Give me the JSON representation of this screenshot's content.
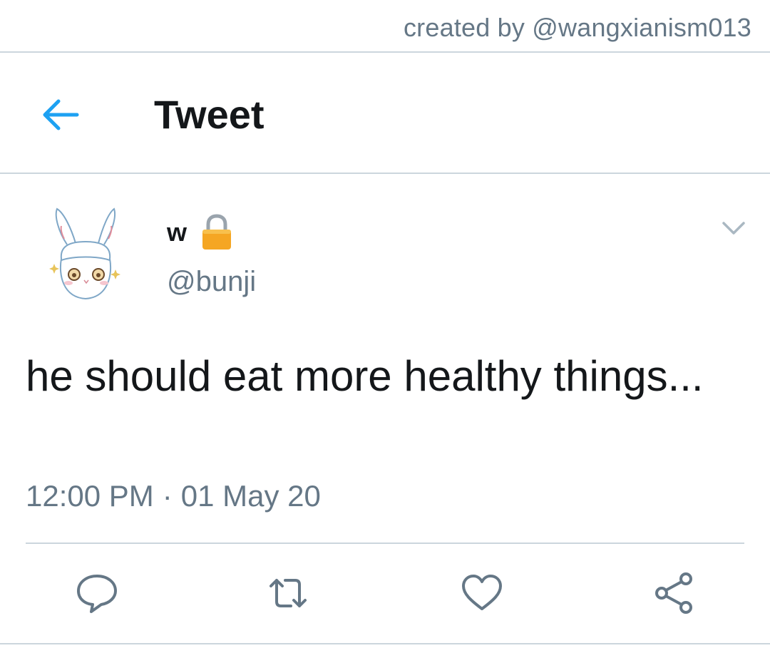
{
  "credit": "created by @wangxianism013",
  "header": {
    "title": "Tweet",
    "back_icon": "back-arrow-icon"
  },
  "tweet": {
    "display_name": "w",
    "handle": "@bunji",
    "protected_icon": "lock-icon",
    "text": "he should eat more healthy things...",
    "time": "12:00 PM",
    "separator": "·",
    "date": "01 May 20"
  },
  "actions": [
    "reply-icon",
    "retweet-icon",
    "like-icon",
    "share-icon"
  ],
  "colors": {
    "accent": "#1da1f2",
    "text": "#14171a",
    "secondary": "#657786",
    "divider": "#ccd6dd",
    "lock": "#f5a623"
  }
}
